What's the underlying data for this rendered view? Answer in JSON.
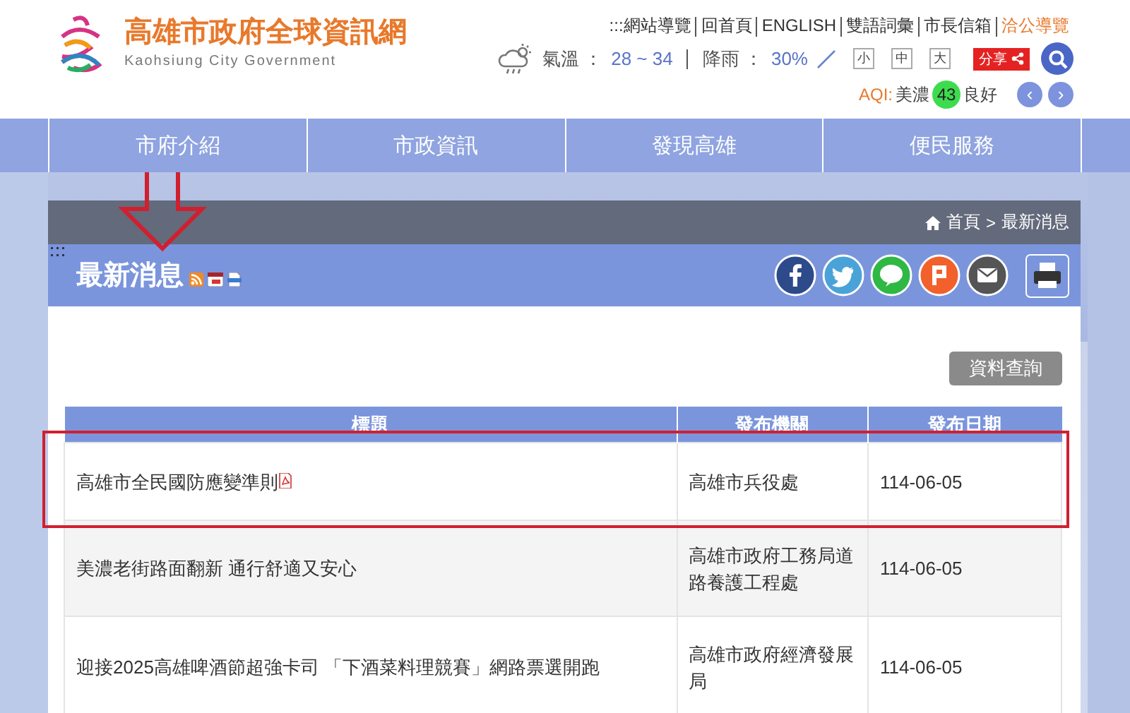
{
  "header": {
    "title": "高雄市政府全球資訊網",
    "subtitle": "Kaohsiung City Government",
    "top_links": [
      {
        "label": ":::網站導覽",
        "highlighted": false
      },
      {
        "label": "回首頁",
        "highlighted": false
      },
      {
        "label": "ENGLISH",
        "highlighted": false
      },
      {
        "label": "雙語詞彙",
        "highlighted": false
      },
      {
        "label": "市長信箱",
        "highlighted": false
      },
      {
        "label": "洽公導覽",
        "highlighted": true
      }
    ],
    "weather": {
      "temperature_label": "氣溫 ：",
      "temperature": "28 ~ 34",
      "rain_label": "降雨 ：",
      "rain": "30%"
    },
    "font_sizes": [
      "小",
      "中",
      "大"
    ],
    "share": "分享",
    "aqi": {
      "label": "AQI:",
      "station": "美濃",
      "value": "43",
      "status": "良好",
      "prev": "‹",
      "next": "›"
    }
  },
  "nav": [
    "市府介紹",
    "市政資訊",
    "發現高雄",
    "便民服務"
  ],
  "breadcrumb": {
    "items": [
      "首頁",
      "最新消息"
    ],
    "separator": ">"
  },
  "page_title": "最新消息",
  "query_button": "資料查詢",
  "table": {
    "columns": [
      "標題",
      "發布機關",
      "發布日期"
    ],
    "rows": [
      {
        "title": "高雄市全民國防應變準則",
        "agency": "高雄市兵役處",
        "date": "114-06-05",
        "pdf": true,
        "annotated": true
      },
      {
        "title": "美濃老街路面翻新 通行舒適又安心",
        "agency": "高雄市政府工務局道路養護工程處",
        "date": "114-06-05",
        "pdf": false,
        "annotated": false
      },
      {
        "title": "迎接2025高雄啤酒節超強卡司 「下酒菜料理競賽」網路票選開跑",
        "agency": "高雄市政府經濟發展局",
        "date": "114-06-05",
        "pdf": false,
        "annotated": false
      }
    ]
  },
  "annotations": [
    {
      "kind": "arrow"
    }
  ]
}
